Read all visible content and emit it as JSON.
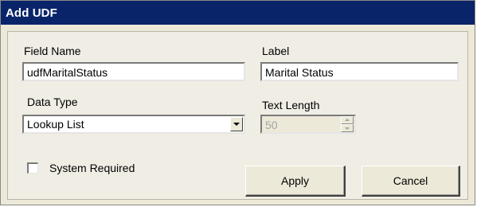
{
  "window": {
    "title": "Add UDF"
  },
  "form": {
    "field_name": {
      "label": "Field Name",
      "value": "udfMaritalStatus"
    },
    "label_field": {
      "label": "Label",
      "value": "Marital Status"
    },
    "data_type": {
      "label": "Data Type",
      "value": "Lookup List"
    },
    "text_length": {
      "label": "Text Length",
      "value": "50",
      "disabled": true
    },
    "system_required": {
      "label": "System Required",
      "checked": false
    }
  },
  "buttons": {
    "apply_label": "Apply",
    "cancel_label": "Cancel"
  },
  "icons": {
    "dropdown": "chevron-down-icon",
    "spinner_up": "triangle-up-icon",
    "spinner_down": "triangle-down-icon"
  },
  "colors": {
    "titlebar": "#0a246a",
    "dialog_bg": "#ece9d8",
    "panel_bg": "#efede4"
  }
}
